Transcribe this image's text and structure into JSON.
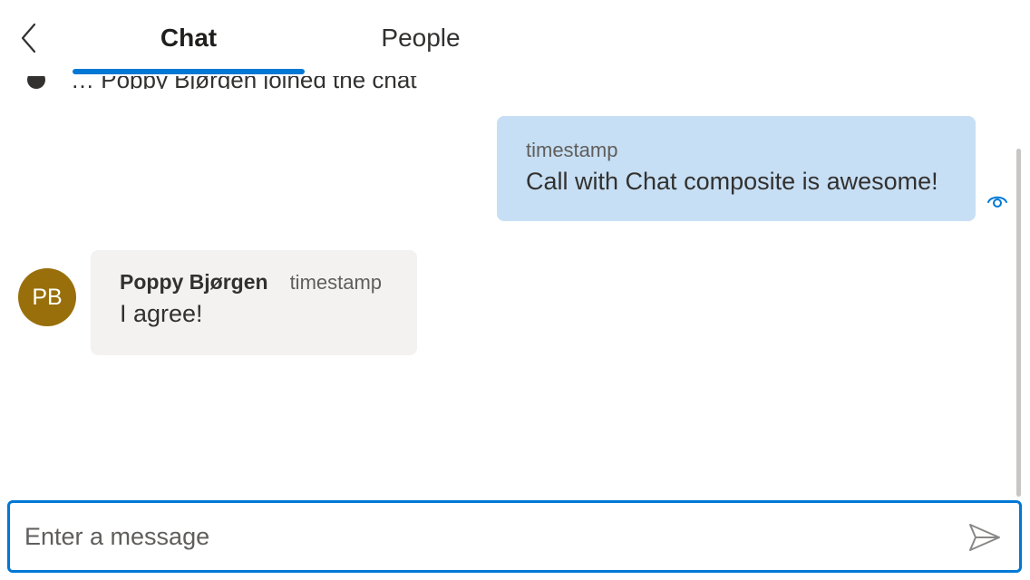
{
  "header": {
    "back_icon": "chevron-left-icon",
    "tabs": [
      {
        "label": "Chat",
        "active": true
      },
      {
        "label": "People",
        "active": false
      }
    ]
  },
  "system_message": {
    "icon": "info-icon",
    "text": "… Poppy Bjørgen joined the chat"
  },
  "messages": [
    {
      "mine": true,
      "timestamp": "timestamp",
      "text": "Call with Chat composite is awesome!",
      "status_icon": "read-receipt-eye-icon"
    },
    {
      "mine": false,
      "avatar_initials": "PB",
      "sender": "Poppy Bjørgen",
      "timestamp": "timestamp",
      "text": "I agree!"
    }
  ],
  "composer": {
    "placeholder": "Enter a message",
    "value": "",
    "send_icon": "send-icon"
  },
  "colors": {
    "accent": "#0078d4",
    "my_bubble": "#c7dff4",
    "other_bubble": "#f3f2f1",
    "avatar": "#986f0b"
  }
}
